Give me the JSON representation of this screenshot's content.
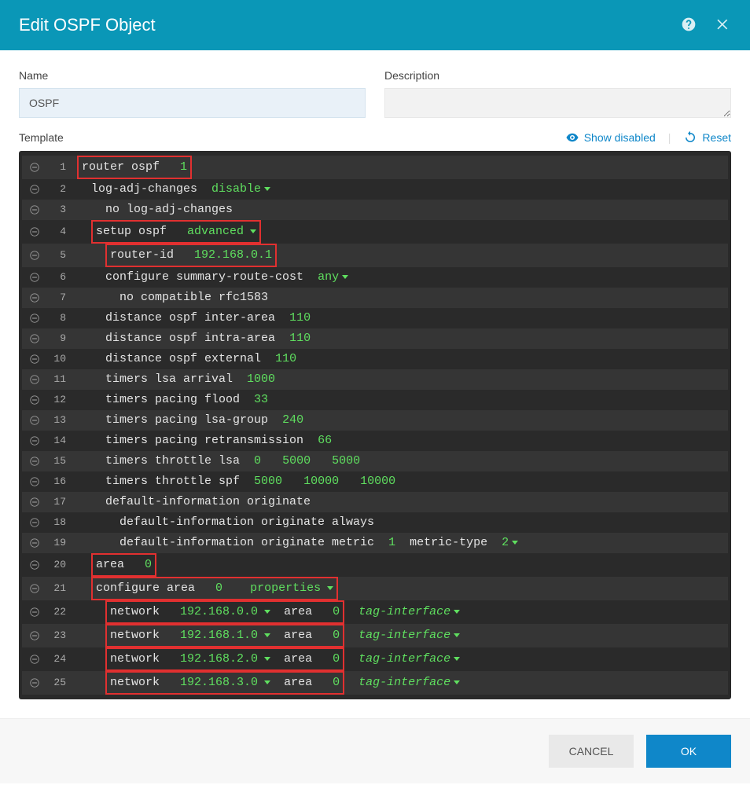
{
  "header": {
    "title": "Edit OSPF Object"
  },
  "form": {
    "name_label": "Name",
    "name_value": "OSPF",
    "desc_label": "Description",
    "desc_value": ""
  },
  "toolbar": {
    "template_label": "Template",
    "show_disabled": "Show disabled",
    "reset": "Reset"
  },
  "lines": {
    "l1": {
      "cmd": "router ospf",
      "val": "1"
    },
    "l2": {
      "cmd": "log-adj-changes",
      "val": "disable"
    },
    "l3": {
      "cmd": "no log-adj-changes"
    },
    "l4": {
      "cmd": "setup ospf",
      "val": "advanced"
    },
    "l5": {
      "cmd": "router-id",
      "val": "192.168.0.1"
    },
    "l6": {
      "cmd": "configure summary-route-cost",
      "val": "any"
    },
    "l7": {
      "cmd": "no compatible rfc1583"
    },
    "l8": {
      "cmd": "distance ospf inter-area",
      "val": "110"
    },
    "l9": {
      "cmd": "distance ospf intra-area",
      "val": "110"
    },
    "l10": {
      "cmd": "distance ospf external",
      "val": "110"
    },
    "l11": {
      "cmd": "timers lsa arrival",
      "val": "1000"
    },
    "l12": {
      "cmd": "timers pacing flood",
      "val": "33"
    },
    "l13": {
      "cmd": "timers pacing lsa-group",
      "val": "240"
    },
    "l14": {
      "cmd": "timers pacing retransmission",
      "val": "66"
    },
    "l15": {
      "cmd": "timers throttle lsa",
      "v1": "0",
      "v2": "5000",
      "v3": "5000"
    },
    "l16": {
      "cmd": "timers throttle spf",
      "v1": "5000",
      "v2": "10000",
      "v3": "10000"
    },
    "l17": {
      "cmd": "default-information originate"
    },
    "l18": {
      "cmd": "default-information originate always"
    },
    "l19": {
      "cmd": "default-information originate metric",
      "v1": "1",
      "cmd2": "metric-type",
      "v2": "2"
    },
    "l20": {
      "cmd": "area",
      "val": "0"
    },
    "l21": {
      "cmd": "configure area",
      "val": "0",
      "opt": "properties"
    },
    "l22": {
      "cmd": "network",
      "ip": "192.168.0.0",
      "area_lbl": "area",
      "area": "0",
      "tag": "tag-interface"
    },
    "l23": {
      "cmd": "network",
      "ip": "192.168.1.0",
      "area_lbl": "area",
      "area": "0",
      "tag": "tag-interface"
    },
    "l24": {
      "cmd": "network",
      "ip": "192.168.2.0",
      "area_lbl": "area",
      "area": "0",
      "tag": "tag-interface"
    },
    "l25": {
      "cmd": "network",
      "ip": "192.168.3.0",
      "area_lbl": "area",
      "area": "0",
      "tag": "tag-interface"
    }
  },
  "footer": {
    "cancel": "CANCEL",
    "ok": "OK"
  }
}
